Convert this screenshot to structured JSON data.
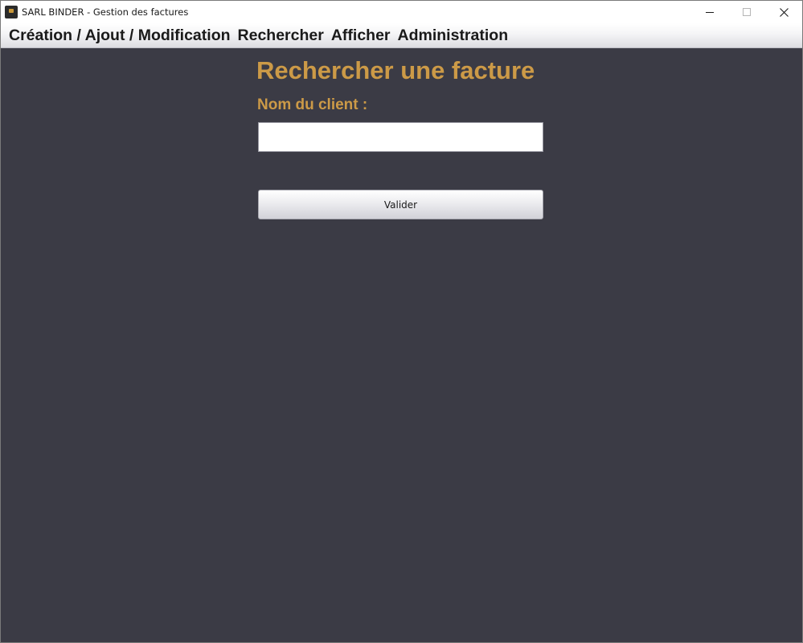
{
  "window": {
    "title": "SARL BINDER - Gestion des factures"
  },
  "menu": {
    "items": [
      {
        "label": "Création / Ajout / Modification"
      },
      {
        "label": "Rechercher"
      },
      {
        "label": "Afficher"
      },
      {
        "label": "Administration"
      }
    ]
  },
  "form": {
    "title": "Rechercher une facture",
    "client_label": "Nom du client :",
    "client_value": "",
    "submit_label": "Valider"
  },
  "colors": {
    "accent": "#cc9a47",
    "background": "#3b3b45"
  }
}
